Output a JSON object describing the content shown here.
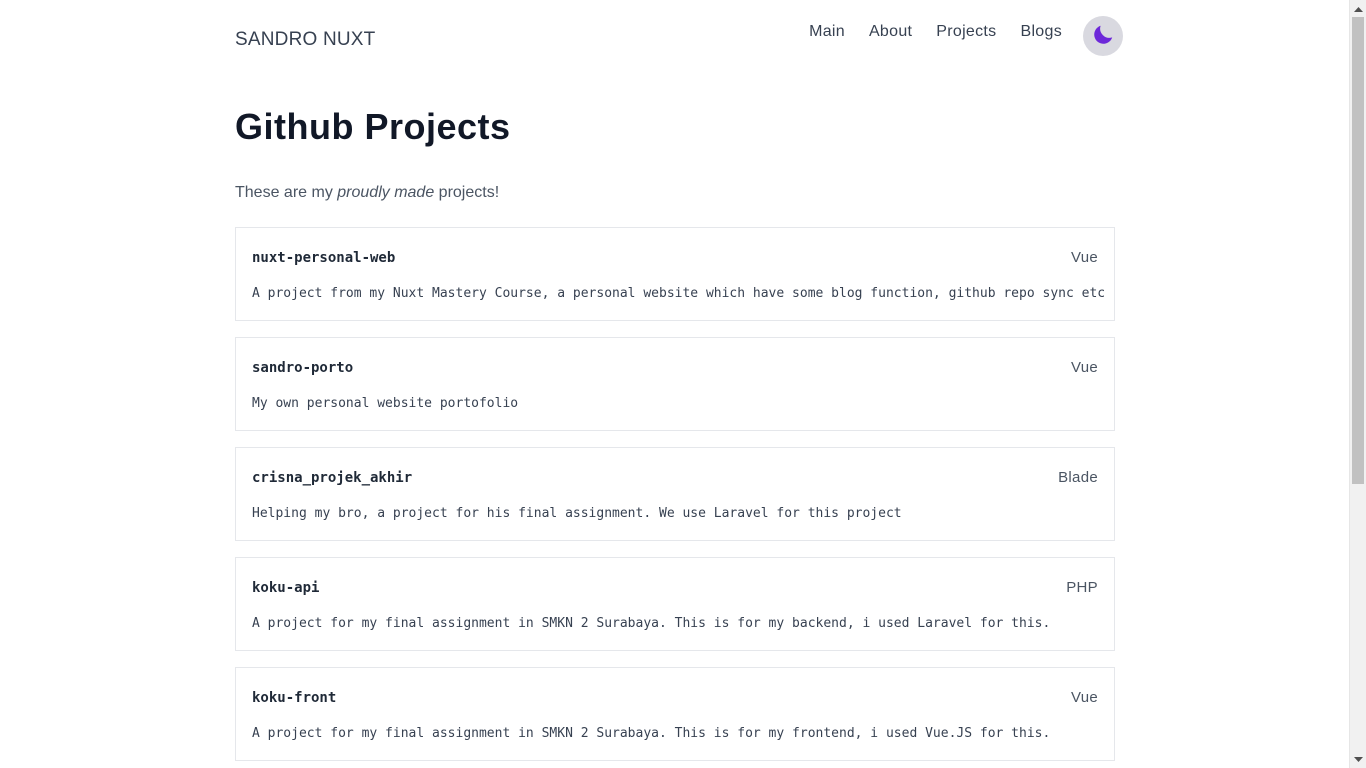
{
  "header": {
    "site_title": "SANDRO NUXT",
    "nav": [
      {
        "label": "Main"
      },
      {
        "label": "About"
      },
      {
        "label": "Projects"
      },
      {
        "label": "Blogs"
      }
    ],
    "theme_toggle_icon": "moon-icon",
    "theme_toggle_color": "#6d28d9"
  },
  "main": {
    "title": "Github Projects",
    "intro_before": "These are my ",
    "intro_emphasis": "proudly made",
    "intro_after": " projects!",
    "projects": [
      {
        "name": "nuxt-personal-web",
        "language": "Vue",
        "description": "A project from my Nuxt Mastery Course, a personal website which have some blog function, github repo sync etc"
      },
      {
        "name": "sandro-porto",
        "language": "Vue",
        "description": "My own personal website portofolio"
      },
      {
        "name": "crisna_projek_akhir",
        "language": "Blade",
        "description": "Helping my bro, a project for his final assignment. We use Laravel for this project"
      },
      {
        "name": "koku-api",
        "language": "PHP",
        "description": "A project for my final assignment in SMKN 2 Surabaya. This is for my backend, i used Laravel for this."
      },
      {
        "name": "koku-front",
        "language": "Vue",
        "description": "A project for my final assignment in SMKN 2 Surabaya. This is for my frontend, i used Vue.JS for this."
      }
    ]
  },
  "scrollbar": {
    "up_icon": "arrow-up-icon",
    "down_icon": "arrow-down-icon"
  }
}
